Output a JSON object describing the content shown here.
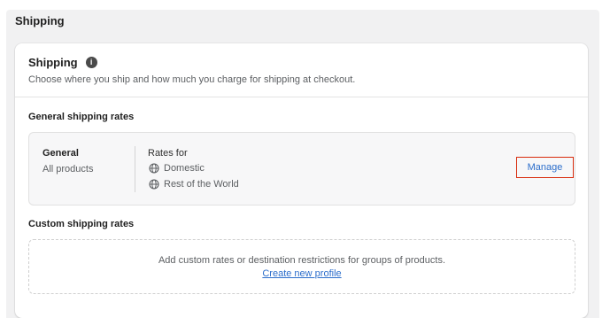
{
  "page": {
    "title": "Shipping"
  },
  "card": {
    "title": "Shipping",
    "subtitle": "Choose where you ship and how much you charge for shipping at checkout."
  },
  "general_rates": {
    "heading": "General shipping rates",
    "profile": {
      "name": "General",
      "products": "All products"
    },
    "rates_for_label": "Rates for",
    "zones": [
      {
        "name": "Domestic",
        "icon": "globe-icon"
      },
      {
        "name": "Rest of the World",
        "icon": "globe-icon"
      }
    ],
    "manage_label": "Manage",
    "highlight_color": "#d82c0d"
  },
  "custom_rates": {
    "heading": "Custom shipping rates",
    "description": "Add custom rates or destination restrictions for groups of products.",
    "create_link": "Create new profile"
  },
  "colors": {
    "link": "#2c6ecb",
    "background": "#f1f1f2"
  }
}
